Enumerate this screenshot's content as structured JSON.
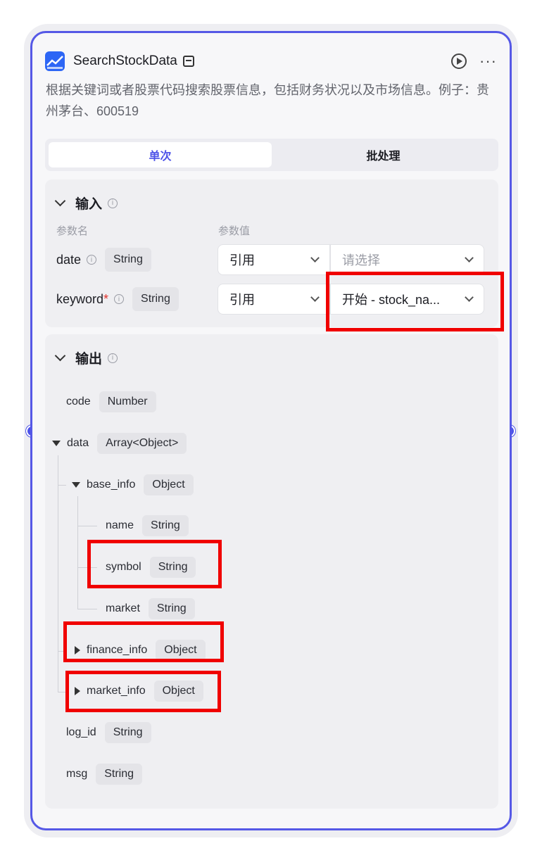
{
  "node": {
    "title": "SearchStockData",
    "description": "根据关键词或者股票代码搜索股票信息，包括财务状况以及市场信息。例子：贵州茅台、600519"
  },
  "tabs": [
    {
      "label": "单次",
      "active": true
    },
    {
      "label": "批处理",
      "active": false
    }
  ],
  "input": {
    "heading": "输入",
    "col_name": "参数名",
    "col_value": "参数值",
    "params": [
      {
        "name": "date",
        "required": false,
        "type": "String",
        "mode": "引用",
        "value": "请选择",
        "value_is_placeholder": true
      },
      {
        "name": "keyword",
        "required": true,
        "required_mark": "*",
        "type": "String",
        "mode": "引用",
        "value": "开始 - stock_na...",
        "value_is_placeholder": false
      }
    ]
  },
  "output": {
    "heading": "输出",
    "fields": [
      {
        "name": "code",
        "type": "Number"
      },
      {
        "name": "data",
        "type": "Array<Object>"
      },
      {
        "name": "base_info",
        "type": "Object"
      },
      {
        "name": "name",
        "type": "String"
      },
      {
        "name": "symbol",
        "type": "String"
      },
      {
        "name": "market",
        "type": "String"
      },
      {
        "name": "finance_info",
        "type": "Object"
      },
      {
        "name": "market_info",
        "type": "Object"
      },
      {
        "name": "log_id",
        "type": "String"
      },
      {
        "name": "msg",
        "type": "String"
      }
    ]
  },
  "colors": {
    "accent": "#4d53e8",
    "highlight": "#f00000",
    "required": "#e0342d"
  }
}
